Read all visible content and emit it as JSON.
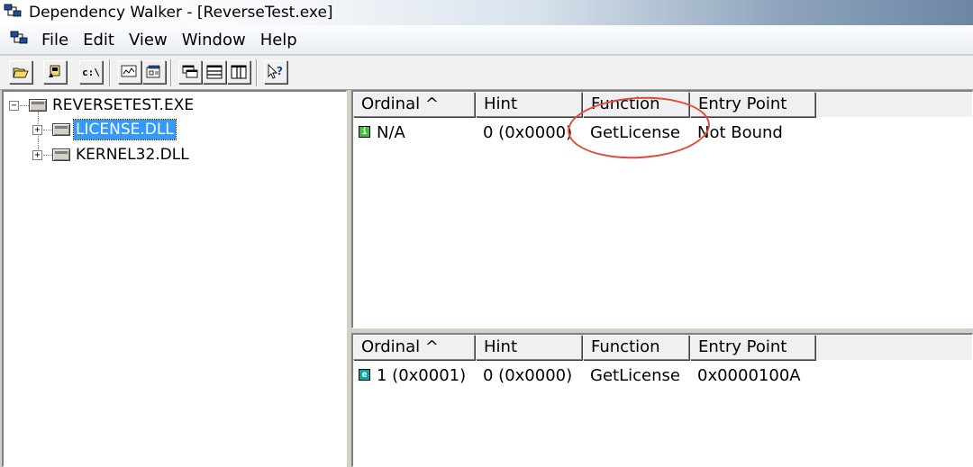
{
  "window": {
    "title": "Dependency Walker - [ReverseTest.exe]",
    "icon": "dependency-walker-icon"
  },
  "menu": {
    "items": [
      "File",
      "Edit",
      "View",
      "Window",
      "Help"
    ]
  },
  "toolbar": {
    "buttons": [
      {
        "name": "open-icon"
      },
      {
        "name": "save-icon"
      },
      {
        "name": "full-paths-icon",
        "label": "c:\\"
      },
      {
        "name": "view-undecorated-icon"
      },
      {
        "name": "properties-icon"
      },
      {
        "name": "tile-icon"
      },
      {
        "name": "split-horizontal-icon"
      },
      {
        "name": "split-vertical-icon"
      },
      {
        "name": "context-help-icon",
        "label": "?"
      }
    ]
  },
  "tree": {
    "root": "REVERSETEST.EXE",
    "children": [
      {
        "label": "LICENSE.DLL",
        "selected": true
      },
      {
        "label": "KERNEL32.DLL",
        "selected": false
      }
    ]
  },
  "imports_list": {
    "columns": [
      "Ordinal ^",
      "Hint",
      "Function",
      "Entry Point"
    ],
    "rows": [
      {
        "icon": "import-function-icon",
        "icon_glyph": "i",
        "ordinal": "N/A",
        "hint": "0  (0x0000)",
        "function": "GetLicense",
        "entry_point": "Not Bound"
      }
    ]
  },
  "exports_list": {
    "columns": [
      "Ordinal ^",
      "Hint",
      "Function",
      "Entry Point"
    ],
    "rows": [
      {
        "icon": "export-function-icon",
        "icon_glyph": "e",
        "ordinal": "1  (0x0001)",
        "hint": "0  (0x0000)",
        "function": "GetLicense",
        "entry_point": "0x0000100A"
      }
    ]
  },
  "colors": {
    "selection": "#3399ff",
    "annotation": "#e04a3a",
    "import_icon": "#3fbf3f",
    "export_icon": "#00a8a8"
  }
}
